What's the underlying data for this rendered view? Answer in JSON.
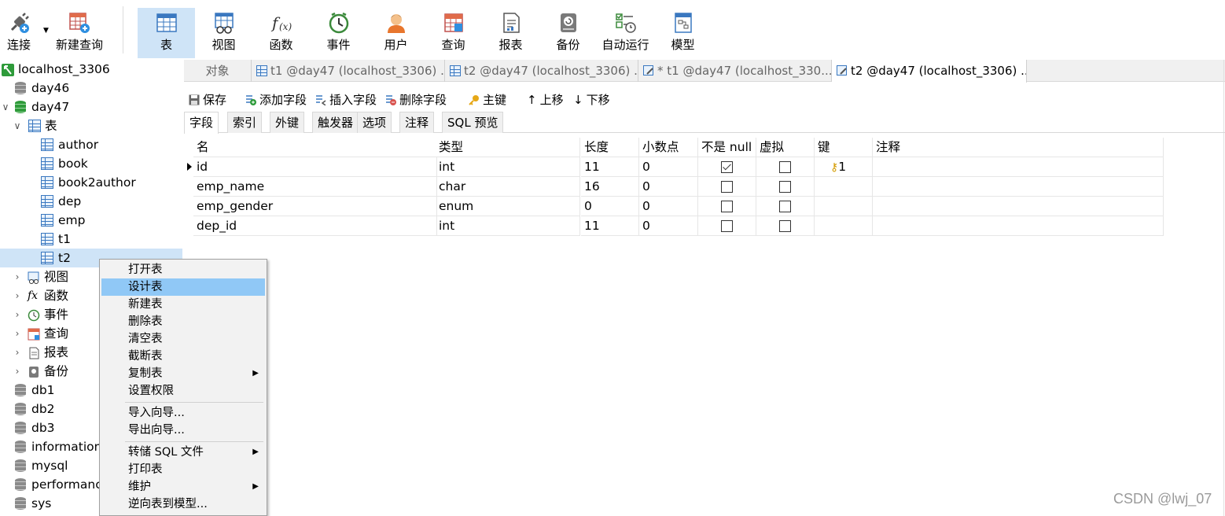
{
  "toolbar": {
    "connect": "连接",
    "new_query": "新建查询",
    "buttons": [
      "表",
      "视图",
      "函数",
      "事件",
      "用户",
      "查询",
      "报表",
      "备份",
      "自动运行",
      "模型"
    ],
    "active": "表"
  },
  "tree": {
    "connection": "localhost_3306",
    "databases_top": [
      "day46",
      "day47"
    ],
    "group_tables": "表",
    "tables": [
      "author",
      "book",
      "book2author",
      "dep",
      "emp",
      "t1",
      "t2"
    ],
    "selected_table": "t2",
    "groups": [
      "视图",
      "函数",
      "事件",
      "查询",
      "报表",
      "备份"
    ],
    "databases_bottom": [
      "db1",
      "db2",
      "db3",
      "information_",
      "mysql",
      "performanc",
      "sys"
    ]
  },
  "tabs": {
    "objects": "对象",
    "items": [
      "t1 @day47 (localhost_3306) ...",
      "t2 @day47 (localhost_3306) ...",
      "* t1 @day47 (localhost_330...",
      "t2 @day47 (localhost_3306) ..."
    ]
  },
  "designer_toolbar": {
    "save": "保存",
    "add_field": "添加字段",
    "insert_field": "插入字段",
    "delete_field": "删除字段",
    "primary_key": "主键",
    "move_up": "上移",
    "move_down": "下移"
  },
  "inner_tabs": [
    "字段",
    "索引",
    "外键",
    "触发器",
    "选项",
    "注释",
    "SQL 预览"
  ],
  "grid": {
    "headers": [
      "名",
      "类型",
      "长度",
      "小数点",
      "不是 null",
      "虚拟",
      "键",
      "注释"
    ],
    "rows": [
      {
        "name": "id",
        "type": "int",
        "length": "11",
        "decimals": "0",
        "not_null": true,
        "virtual": false,
        "key": "1"
      },
      {
        "name": "emp_name",
        "type": "char",
        "length": "16",
        "decimals": "0",
        "not_null": false,
        "virtual": false,
        "key": ""
      },
      {
        "name": "emp_gender",
        "type": "enum",
        "length": "0",
        "decimals": "0",
        "not_null": false,
        "virtual": false,
        "key": ""
      },
      {
        "name": "dep_id",
        "type": "int",
        "length": "11",
        "decimals": "0",
        "not_null": false,
        "virtual": false,
        "key": ""
      }
    ]
  },
  "context_menu": {
    "items": [
      "打开表",
      "设计表",
      "新建表",
      "删除表",
      "清空表",
      "截断表",
      "复制表",
      "设置权限",
      "导入向导...",
      "导出向导...",
      "转储 SQL 文件",
      "打印表",
      "维护",
      "逆向表到模型..."
    ],
    "highlighted": "设计表"
  },
  "watermark": "CSDN @lwj_07",
  "colors": {
    "selection": "#cfe4f7",
    "menu_highlight": "#90c8f6",
    "table_icon": "#3a78c0"
  }
}
